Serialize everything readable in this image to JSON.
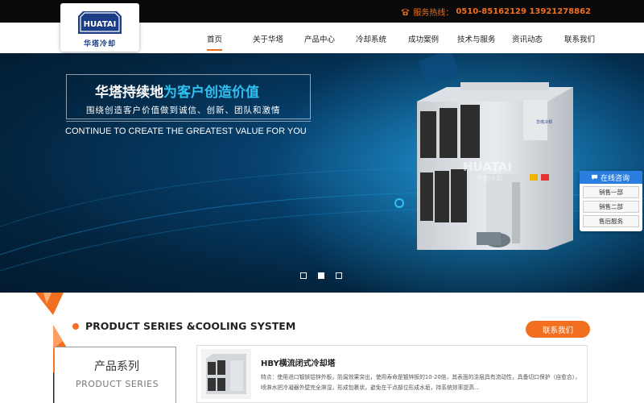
{
  "header": {
    "hotline_label": "服务热线：",
    "hotline_numbers": "0510-85162129  13921278862",
    "logo_badge_text": "HUATAI",
    "logo_caption": "华塔冷却"
  },
  "nav": {
    "items": [
      {
        "label": "首页",
        "active": true
      },
      {
        "label": "关于华塔"
      },
      {
        "label": "产品中心"
      },
      {
        "label": "冷却系统"
      },
      {
        "label": "成功案例"
      },
      {
        "label": "技术与服务"
      },
      {
        "label": "资讯动态"
      },
      {
        "label": "联系我们"
      }
    ]
  },
  "hero": {
    "slogan_main": "华塔持续地",
    "slogan_highlight": "为客户创造价值",
    "slogan_sub": "围绕创造客户价值做到诚信、创新、团队和激情",
    "slogan_en": "CONTINUE TO CREATE THE GREATEST VALUE FOR YOU",
    "product_plate": "华塔冷却",
    "watermark_text": "HUATAI",
    "watermark_sub": "华塔冷却",
    "slide_count": 3,
    "active_slide": 2
  },
  "chat": {
    "title": "在线咨询",
    "items": [
      "销售一部",
      "销售二部",
      "售后服务"
    ]
  },
  "section": {
    "title": "PRODUCT SERIES &COOLING SYSTEM",
    "contact_button": "联系我们",
    "side_title_cn": "产品系列",
    "side_title_en": "PRODUCT SERIES",
    "card_title": "HBY横流闭式冷却塔",
    "card_desc": "特点：使用进口镀镁铝锌外板，防腐效果突出，使用寿命是镀锌板的10-20倍，其表面的涂层具有流动性，具备切口保护（自愈合），喷淋水把冷凝器外壁完全淋湿，形成包裹状，避免在干点部位形成水垢，持系统效率提高..."
  },
  "colors": {
    "accent": "#f26f1f",
    "brand_blue": "#1d3e86",
    "hero_highlight": "#2fc1f2",
    "chat_blue": "#2a7edf"
  }
}
